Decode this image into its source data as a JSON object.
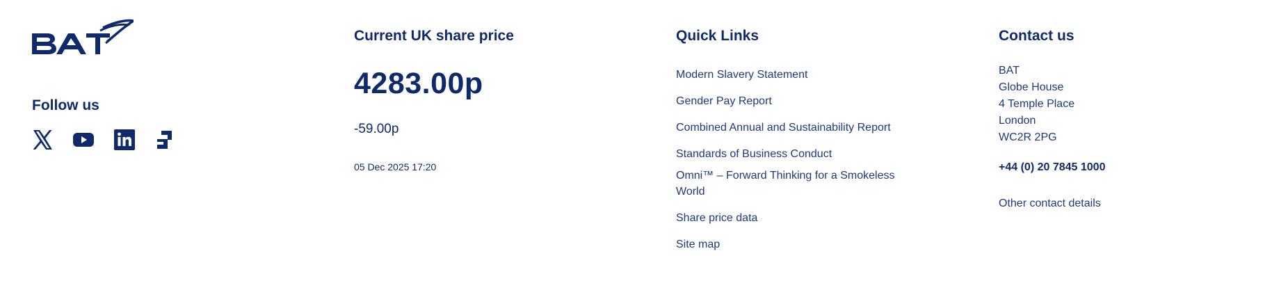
{
  "brand": {
    "logo_text": "BAT",
    "logo_icon": "bat-logo",
    "color": "#0e2a6b"
  },
  "follow": {
    "title": "Follow us",
    "icons": [
      "x-icon",
      "youtube-icon",
      "linkedin-icon",
      "glassdoor-icon"
    ]
  },
  "share": {
    "title": "Current UK share price",
    "price": "4283.00p",
    "change": "-59.00p",
    "timestamp": "05 Dec 2025 17:20"
  },
  "quick_links": {
    "title": "Quick Links",
    "items": [
      "Modern Slavery Statement",
      "Gender Pay Report",
      "Combined Annual and Sustainability Report",
      "Standards of Business Conduct",
      "Omni™ – Forward Thinking for a Smokeless World",
      "Share price data",
      "Site map"
    ]
  },
  "contact": {
    "title": "Contact us",
    "address": [
      "BAT",
      "Globe House",
      "4 Temple Place",
      "London",
      "WC2R 2PG"
    ],
    "phone": "+44 (0) 20 7845 1000",
    "other_link": "Other contact details"
  }
}
